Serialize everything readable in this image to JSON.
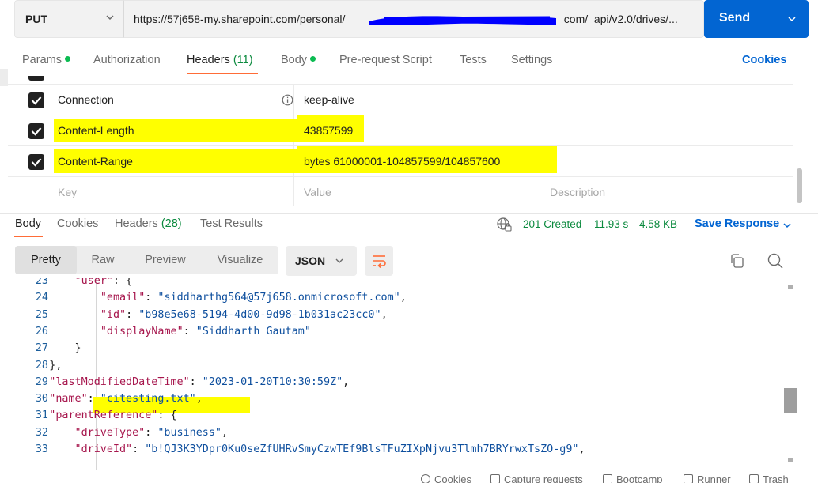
{
  "request": {
    "method": "PUT",
    "url_start": "https://57j658-my.sharepoint.com/personal/",
    "url_end": "_com/_api/v2.0/drives/...",
    "send_label": "Send"
  },
  "request_tabs": [
    {
      "label": "Params",
      "dot": true
    },
    {
      "label": "Authorization"
    },
    {
      "label": "Headers",
      "count": "(11)"
    },
    {
      "label": "Body",
      "dot": true
    },
    {
      "label": "Pre-request Script"
    },
    {
      "label": "Tests"
    },
    {
      "label": "Settings"
    }
  ],
  "cookies_link": "Cookies",
  "headers": [
    {
      "key": "Connection",
      "value": "keep-alive",
      "checked": true,
      "info": true
    },
    {
      "key": "Content-Length",
      "value": "43857599",
      "checked": true,
      "highlight": true
    },
    {
      "key": "Content-Range",
      "value": "bytes 61000001-104857599/104857600",
      "checked": true,
      "highlight": true
    }
  ],
  "headers_placeholder": {
    "key": "Key",
    "value": "Value",
    "description": "Description"
  },
  "response_tabs": [
    {
      "label": "Body"
    },
    {
      "label": "Cookies"
    },
    {
      "label": "Headers",
      "count": "(28)"
    },
    {
      "label": "Test Results"
    }
  ],
  "response_status": {
    "status": "201 Created",
    "time": "11.93 s",
    "size": "4.58 KB",
    "save_label": "Save Response"
  },
  "view_modes": [
    "Pretty",
    "Raw",
    "Preview",
    "Visualize"
  ],
  "format": "JSON",
  "code_lines": [
    {
      "n": "23",
      "indent": 8,
      "parts": [
        [
          "k",
          "\"user\""
        ],
        [
          "p",
          ": {"
        ]
      ]
    },
    {
      "n": "24",
      "indent": 12,
      "parts": [
        [
          "k",
          "\"email\""
        ],
        [
          "p",
          ": "
        ],
        [
          "s",
          "\"siddharthg564@57j658.onmicrosoft.com\""
        ],
        [
          "p",
          ","
        ]
      ]
    },
    {
      "n": "25",
      "indent": 12,
      "parts": [
        [
          "k",
          "\"id\""
        ],
        [
          "p",
          ": "
        ],
        [
          "s",
          "\"b98e5e68-5194-4d00-9d98-1b031ac23cc0\""
        ],
        [
          "p",
          ","
        ]
      ]
    },
    {
      "n": "26",
      "indent": 12,
      "parts": [
        [
          "k",
          "\"displayName\""
        ],
        [
          "p",
          ": "
        ],
        [
          "s",
          "\"Siddharth Gautam\""
        ]
      ]
    },
    {
      "n": "27",
      "indent": 8,
      "parts": [
        [
          "p",
          "}"
        ]
      ]
    },
    {
      "n": "28",
      "indent": 4,
      "parts": [
        [
          "p",
          "},"
        ]
      ]
    },
    {
      "n": "29",
      "indent": 4,
      "parts": [
        [
          "k",
          "\"lastModifiedDateTime\""
        ],
        [
          "p",
          ": "
        ],
        [
          "s",
          "\"2023-01-20T10:30:59Z\""
        ],
        [
          "p",
          ","
        ]
      ]
    },
    {
      "n": "30",
      "indent": 4,
      "highlight": true,
      "parts": [
        [
          "k",
          "\"name\""
        ],
        [
          "p",
          ": "
        ],
        [
          "s",
          "\"citesting.txt\""
        ],
        [
          "p",
          ","
        ]
      ]
    },
    {
      "n": "31",
      "indent": 4,
      "parts": [
        [
          "k",
          "\"parentReference\""
        ],
        [
          "p",
          ": {"
        ]
      ]
    },
    {
      "n": "32",
      "indent": 8,
      "parts": [
        [
          "k",
          "\"driveType\""
        ],
        [
          "p",
          ": "
        ],
        [
          "s",
          "\"business\""
        ],
        [
          "p",
          ","
        ]
      ]
    },
    {
      "n": "33",
      "indent": 8,
      "parts": [
        [
          "k",
          "\"driveId\""
        ],
        [
          "p",
          ": "
        ],
        [
          "s",
          "\"b!QJ3K3YDpr0Ku0seZfUHRvSmyCzwTEf9BlsTFuZIXpNjvu3Tlmh7BRYrwxTsZO-g9\""
        ],
        [
          "p",
          ","
        ]
      ]
    }
  ],
  "footer": [
    "Cookies",
    "Capture requests",
    "Bootcamp",
    "Runner",
    "Trash"
  ],
  "colors": {
    "accent": "#0265d2",
    "tab_active": "#ff6c37",
    "success": "#0b8a3e",
    "highlight": "#ffff00",
    "redaction": "#0000ff"
  }
}
